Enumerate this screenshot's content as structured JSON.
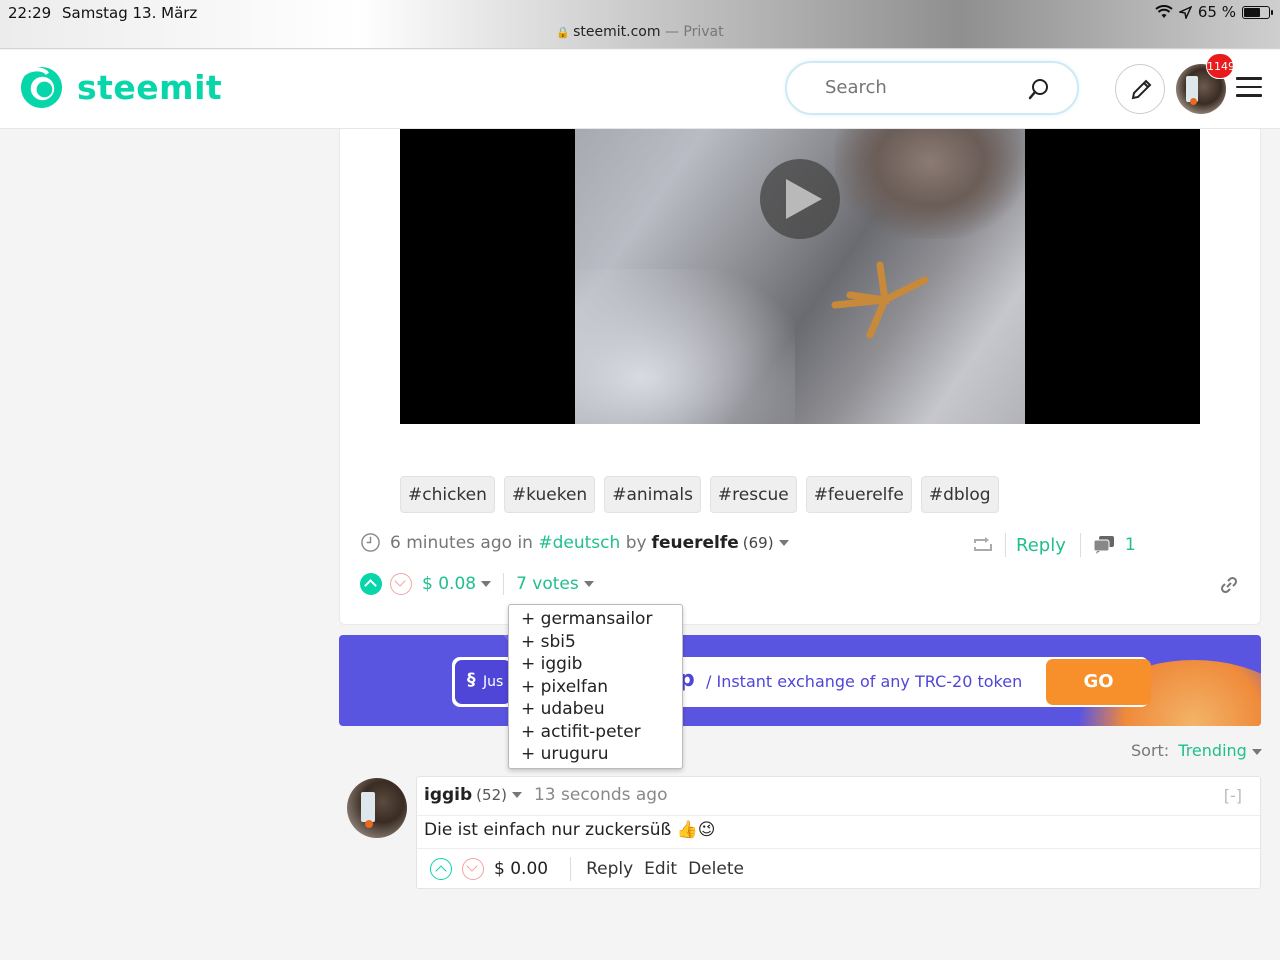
{
  "status_bar": {
    "time": "22:29",
    "date": "Samstag 13. März",
    "url": "steemit.com",
    "mode": "— Privat",
    "battery": "65 %"
  },
  "header": {
    "brand": "steemit",
    "search_placeholder": "Search",
    "notification_count": "1149"
  },
  "post": {
    "tags": [
      "#chicken",
      "#kueken",
      "#animals",
      "#rescue",
      "#feuerelfe",
      "#dblog"
    ],
    "time_ago": "6 minutes ago",
    "in_label": "in",
    "category": "#deutsch",
    "by_label": "by",
    "author": "feuerelfe",
    "reputation": "(69)",
    "reply_label": "Reply",
    "comment_count": "1",
    "payout": "$ 0.08",
    "votes_label": "7 votes",
    "voters": [
      "+ germansailor",
      "+ sbi5",
      "+ iggib",
      "+ pixelfan",
      "+ udabeu",
      "+ actifit-peter",
      "+ uruguru"
    ]
  },
  "banner": {
    "left_text": "Jus",
    "brand_letter": "p",
    "message": "/ Instant exchange of any TRC-20 token",
    "cta": "GO"
  },
  "comments": {
    "sort_label": "Sort:",
    "sort_value": "Trending",
    "items": [
      {
        "author": "iggib",
        "reputation": "(52)",
        "time_ago": "13 seconds ago",
        "collapse": "[-]",
        "body": "Die ist einfach nur zuckersüß 👍😉",
        "payout": "$ 0.00",
        "reply": "Reply",
        "edit": "Edit",
        "delete": "Delete"
      }
    ]
  }
}
